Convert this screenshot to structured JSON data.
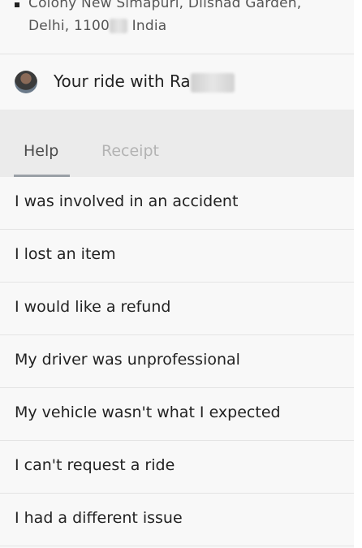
{
  "address": {
    "line1": "Colony New Simapuri, Dilshad Garden,",
    "line2_prefix": "Delhi, 1100",
    "line2_suffix": " India"
  },
  "ride": {
    "label": "Your ride with Ra"
  },
  "tabs": [
    {
      "label": "Help",
      "active": true
    },
    {
      "label": "Receipt",
      "active": false
    }
  ],
  "help_items": [
    {
      "label": "I was involved in an accident"
    },
    {
      "label": "I lost an item"
    },
    {
      "label": "I would like a refund"
    },
    {
      "label": "My driver was unprofessional"
    },
    {
      "label": "My vehicle wasn't what I expected"
    },
    {
      "label": "I can't request a ride"
    },
    {
      "label": "I had a different issue"
    }
  ],
  "colors": {
    "background": "#f8f8f8",
    "tab_bar": "#ebebeb",
    "active_tab_text": "#4a4a4a",
    "inactive_tab_text": "#b3b3b3",
    "text": "#222222"
  }
}
